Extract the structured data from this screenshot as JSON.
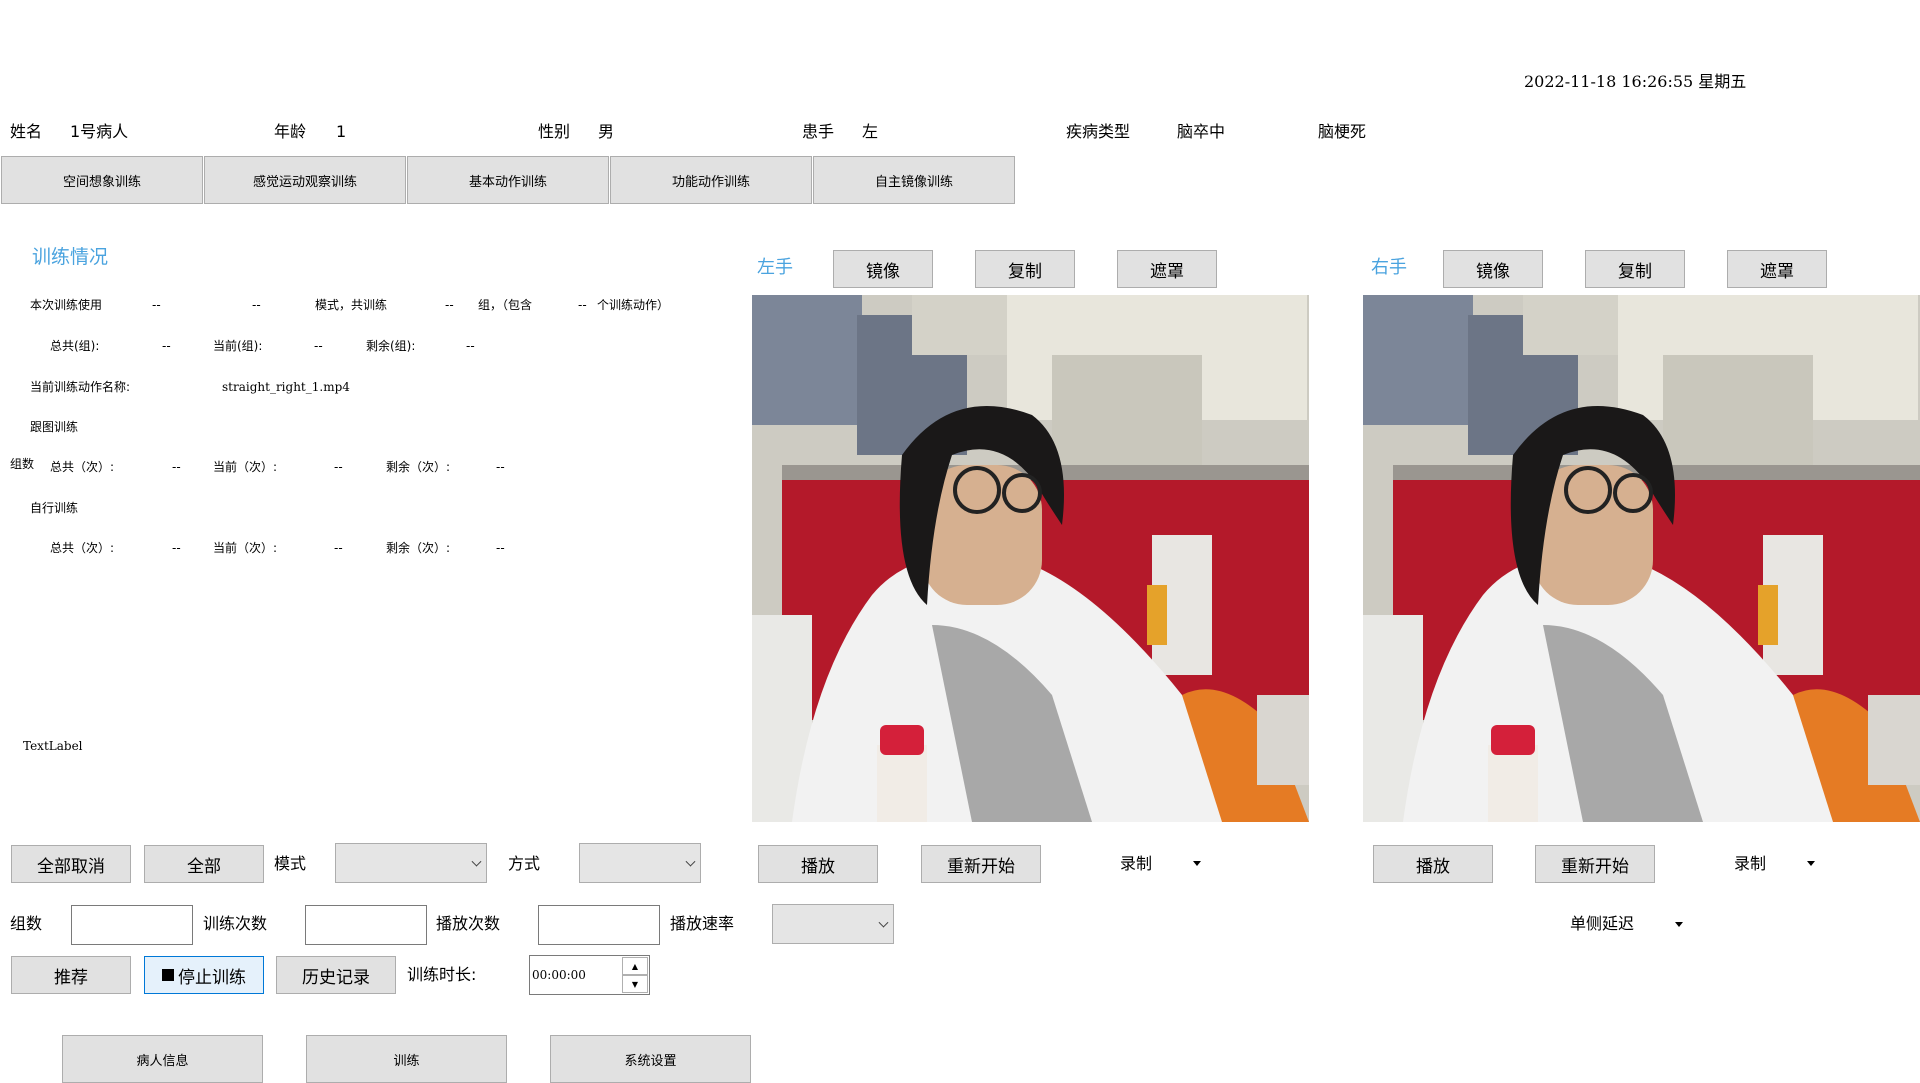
{
  "datetime": "2022-11-18 16:26:55 星期五",
  "patient": {
    "name_label": "姓名",
    "name_value": "1号病人",
    "age_label": "年龄",
    "age_value": "1",
    "gender_label": "性别",
    "gender_value": "男",
    "hand_label": "患手",
    "hand_value": "左",
    "disease_label": "疾病类型",
    "disease_value": "脑卒中",
    "disease_sub": "脑梗死"
  },
  "tabs": [
    "空间想象训练",
    "感觉运动观察训练",
    "基本动作训练",
    "功能动作训练",
    "自主镜像训练"
  ],
  "training_status": {
    "title": "训练情况",
    "line1": {
      "prefix": "本次训练使用",
      "v1": "--",
      "v2": "--",
      "mode_text": "模式，共训练",
      "v3": "--",
      "group_text": "组，（包含",
      "v4": "--",
      "suffix": "个训练动作）"
    },
    "groups": {
      "total_label": "总共(组):",
      "total": "--",
      "current_label": "当前(组):",
      "current": "--",
      "remain_label": "剩余(组):",
      "remain": "--"
    },
    "action_name_label": "当前训练动作名称:",
    "action_name_value": "straight_right_1.mp4",
    "follow_label": "跟图训练",
    "group_count_label": "组数",
    "follow_counts": {
      "total_label": "总共（次）:",
      "total": "--",
      "current_label": "当前（次）:",
      "current": "--",
      "remain_label": "剩余（次）:",
      "remain": "--"
    },
    "self_label": "自行训练",
    "self_counts": {
      "total_label": "总共（次）:",
      "total": "--",
      "current_label": "当前（次）:",
      "current": "--",
      "remain_label": "剩余（次）:",
      "remain": "--"
    },
    "text_label": "TextLabel"
  },
  "left_panel": {
    "title": "左手",
    "mirror": "镜像",
    "copy": "复制",
    "mask": "遮罩",
    "play": "播放",
    "restart": "重新开始",
    "record": "录制"
  },
  "right_panel": {
    "title": "右手",
    "mirror": "镜像",
    "copy": "复制",
    "mask": "遮罩",
    "play": "播放",
    "restart": "重新开始",
    "record": "录制",
    "delay": "单侧延迟"
  },
  "controls": {
    "cancel_all": "全部取消",
    "all": "全部",
    "mode_label": "模式",
    "method_label": "方式",
    "groups_label": "组数",
    "train_count_label": "训练次数",
    "play_count_label": "播放次数",
    "play_rate_label": "播放速率",
    "recommend": "推荐",
    "stop_training": "停止训练",
    "history": "历史记录",
    "duration_label": "训练时长:",
    "duration_value": "00:00:00"
  },
  "bottom_nav": [
    "病人信息",
    "训练",
    "系统设置"
  ],
  "colors": {
    "accent_blue": "#4aa3df",
    "button_bg": "#e1e1e1",
    "active_border": "#0078d7"
  }
}
